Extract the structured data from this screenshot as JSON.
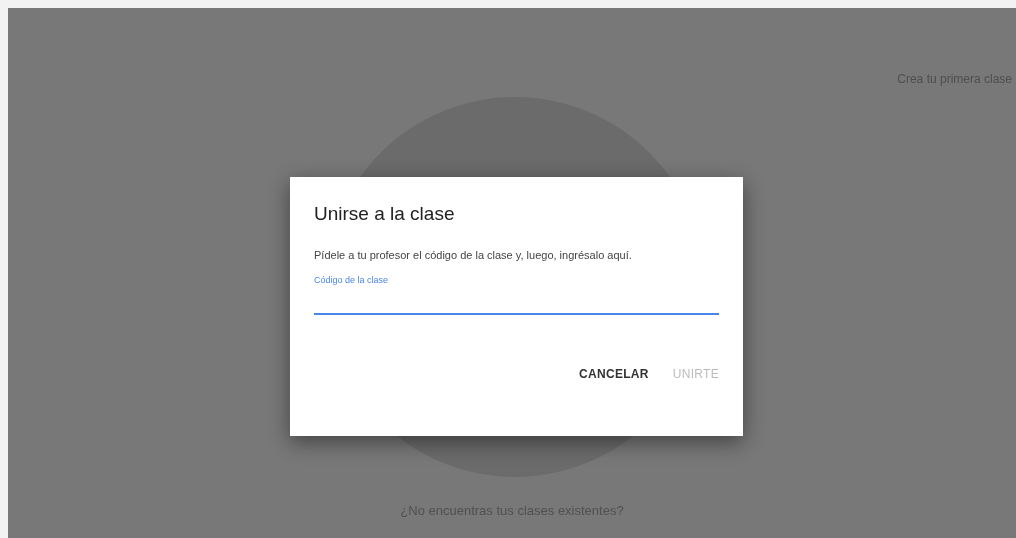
{
  "page": {
    "header_link": "Crea tu primera clase",
    "footer_text": "¿No encuentras tus clases existentes?"
  },
  "dialog": {
    "title": "Unirse a la clase",
    "description": "Pídele a tu profesor el código de la clase y, luego, ingrésalo aquí.",
    "field": {
      "label": "Código de la clase",
      "focused": true
    },
    "buttons": [
      {
        "label": "CANCELAR",
        "disabled": false
      },
      {
        "label": "UNIRTE",
        "disabled": true
      }
    ]
  }
}
